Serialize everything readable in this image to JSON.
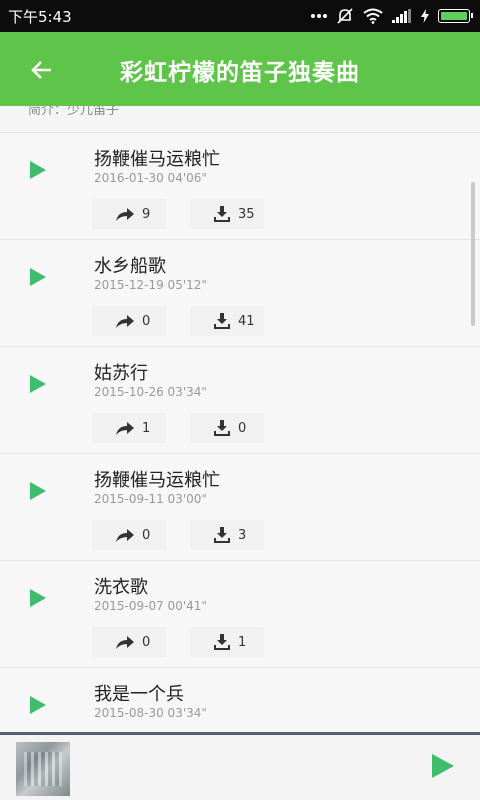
{
  "status": {
    "time": "下午5:43"
  },
  "header": {
    "title": "彩虹柠檬的笛子独奏曲"
  },
  "intro": {
    "text": "简介：少儿笛子"
  },
  "tracks": [
    {
      "title": "扬鞭催马运粮忙",
      "date": "2016-01-30  04'06\"",
      "shares": "9",
      "downloads": "35"
    },
    {
      "title": "水乡船歌",
      "date": "2015-12-19  05'12\"",
      "shares": "0",
      "downloads": "41"
    },
    {
      "title": "姑苏行",
      "date": "2015-10-26  03'34\"",
      "shares": "1",
      "downloads": "0"
    },
    {
      "title": "扬鞭催马运粮忙",
      "date": "2015-09-11  03'00\"",
      "shares": "0",
      "downloads": "3"
    },
    {
      "title": "洗衣歌",
      "date": "2015-09-07  00'41\"",
      "shares": "0",
      "downloads": "1"
    },
    {
      "title": "我是一个兵",
      "date": "2015-08-30  03'34\"",
      "shares": "",
      "downloads": ""
    }
  ],
  "colors": {
    "accent": "#5ec54a",
    "play": "#3fbc6e"
  },
  "icons": {
    "back": "arrow-left-icon",
    "share": "share-icon",
    "download": "download-icon",
    "play": "play-icon"
  }
}
